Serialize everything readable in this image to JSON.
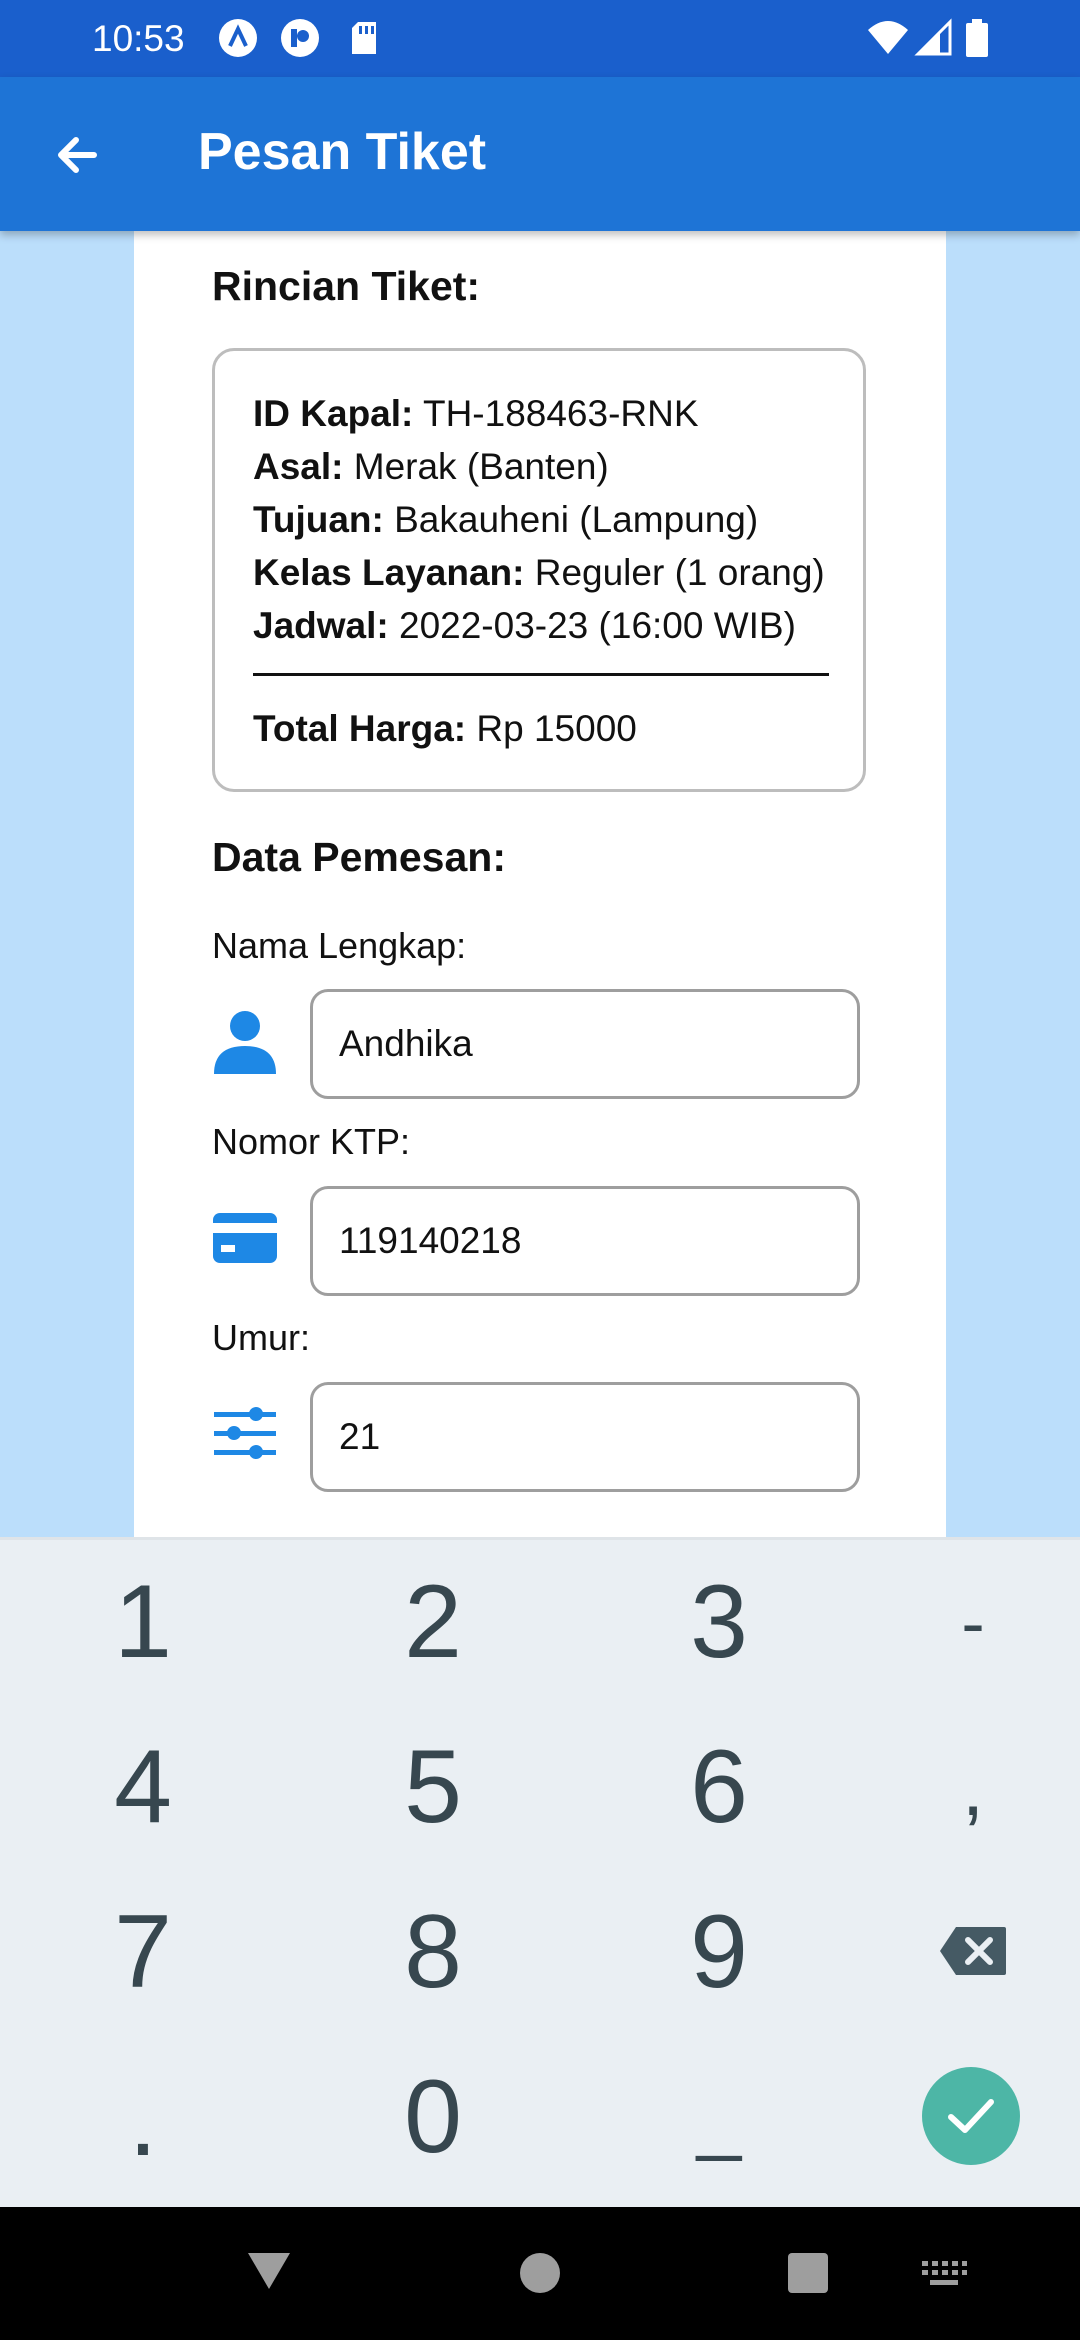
{
  "status_bar": {
    "time": "10:53",
    "icons": [
      "a-icon",
      "p-icon",
      "sd-card-icon",
      "wifi-icon",
      "signal-icon",
      "battery-icon"
    ]
  },
  "app_bar": {
    "title": "Pesan Tiket",
    "back_icon": "arrow-back-icon"
  },
  "ticket": {
    "heading": "Rincian Tiket:",
    "id_label": "ID Kapal:",
    "id_value": " TH-188463-RNK",
    "asal_label": "Asal:",
    "asal_value": " Merak (Banten)",
    "tujuan_label": "Tujuan:",
    "tujuan_value": " Bakauheni (Lampung)",
    "kelas_label": "Kelas Layanan:",
    "kelas_value": " Reguler (1 orang)",
    "jadwal_label": "Jadwal:",
    "jadwal_value": " 2022-03-23 (16:00 WIB)",
    "total_label": "Total Harga:",
    "total_value": " Rp 15000"
  },
  "booker": {
    "heading": "Data Pemesan:",
    "name_label": "Nama Lengkap:",
    "name_value": "Andhika",
    "ktp_label": "Nomor KTP:",
    "ktp_value": "119140218",
    "age_label": "Umur:",
    "age_value": "21"
  },
  "keyboard": {
    "rows": [
      [
        "1",
        "2",
        "3",
        "-"
      ],
      [
        "4",
        "5",
        "6",
        ","
      ],
      [
        "7",
        "8",
        "9",
        ""
      ],
      [
        ".",
        "0",
        "_",
        ""
      ]
    ]
  },
  "colors": {
    "status_bar": "#1a5fcc",
    "app_bar": "#1e74d6",
    "background": "#bbdefb",
    "icon_blue": "#1e88e5",
    "enter_key": "#4db6a6"
  }
}
